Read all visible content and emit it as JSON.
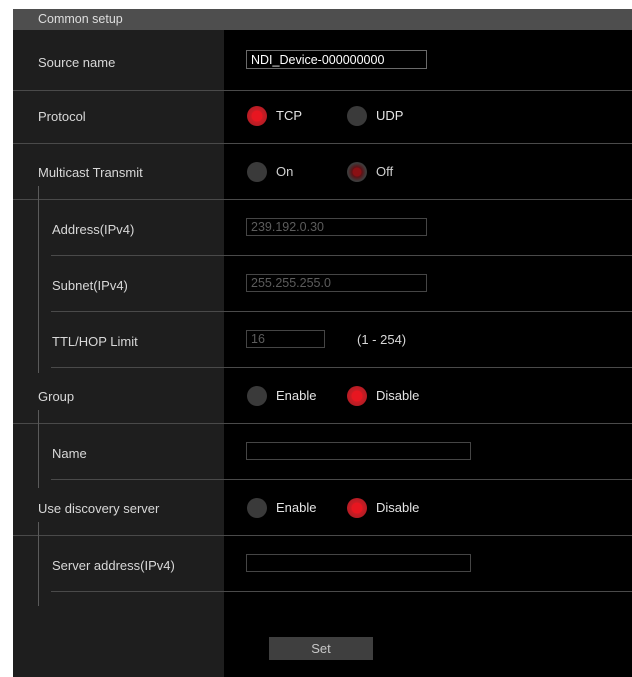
{
  "section_title": "Common setup",
  "source_name": {
    "label": "Source name",
    "value": "NDI_Device-000000000"
  },
  "protocol": {
    "label": "Protocol",
    "options": [
      "TCP",
      "UDP"
    ],
    "selected": "TCP"
  },
  "multicast": {
    "label": "Multicast Transmit",
    "options": [
      "On",
      "Off"
    ],
    "selected": "Off",
    "address": {
      "label": "Address(IPv4)",
      "value": "239.192.0.30"
    },
    "subnet": {
      "label": "Subnet(IPv4)",
      "value": "255.255.255.0"
    },
    "ttl": {
      "label": "TTL/HOP Limit",
      "value": "16",
      "range": "(1 - 254)"
    }
  },
  "group": {
    "label": "Group",
    "options": [
      "Enable",
      "Disable"
    ],
    "selected": "Disable",
    "name": {
      "label": "Name",
      "value": ""
    }
  },
  "discovery": {
    "label": "Use discovery server",
    "options": [
      "Enable",
      "Disable"
    ],
    "selected": "Disable",
    "server_address": {
      "label": "Server address(IPv4)",
      "value": ""
    }
  },
  "set_button": "Set",
  "colors": {
    "accent_red": "#e81620",
    "background": "#000000",
    "label_column": "#1e1e1e",
    "header": "#4e4e4e"
  }
}
